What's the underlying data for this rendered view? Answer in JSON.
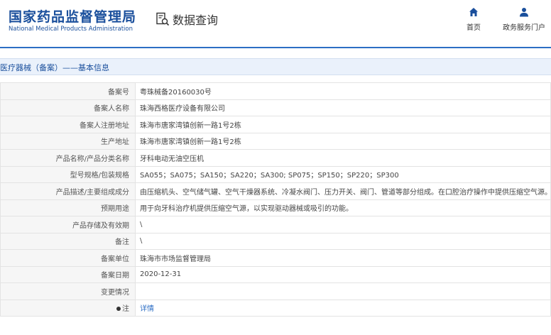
{
  "header": {
    "logo_cn": "国家药品监督管理局",
    "logo_en": "National Medical Products Administration",
    "query_label": "数据查询",
    "nav": {
      "home": "首页",
      "portal": "政务服务门户"
    }
  },
  "section_title": "医疗器械（备案）——基本信息",
  "rows": [
    {
      "label": "备案号",
      "value": "粤珠械备20160030号"
    },
    {
      "label": "备案人名称",
      "value": "珠海西格医疗设备有限公司"
    },
    {
      "label": "备案人注册地址",
      "value": "珠海市唐家湾镇创新一路1号2栋"
    },
    {
      "label": "生产地址",
      "value": "珠海市唐家湾镇创新一路1号2栋"
    },
    {
      "label": "产品名称/产品分类名称",
      "value": "牙科电动无油空压机"
    },
    {
      "label": "型号规格/包装规格",
      "value": "SA055；SA075；SA150；SA220；SA300; SP075；SP150；SP220；SP300"
    },
    {
      "label": "产品描述/主要组成成分",
      "value": "由压缩机头、空气储气罐、空气干燥器系统、冷凝水阀门、压力开关、阀门、管道等部分组成。在口腔治疗操作中提供压缩空气源。"
    },
    {
      "label": "预期用途",
      "value": "用于向牙科治疗机提供压缩空气源，以实现驱动器械或吸引的功能。"
    },
    {
      "label": "产品存储及有效期",
      "value": "\\"
    },
    {
      "label": "备注",
      "value": "\\"
    },
    {
      "label": "备案单位",
      "value": "珠海市市场监督管理局"
    },
    {
      "label": "备案日期",
      "value": "2020-12-31"
    },
    {
      "label": "变更情况",
      "value": ""
    },
    {
      "label": "注",
      "value": "详情"
    }
  ],
  "colors": {
    "brand": "#1a4f9c",
    "accent": "#2d6ec4"
  }
}
